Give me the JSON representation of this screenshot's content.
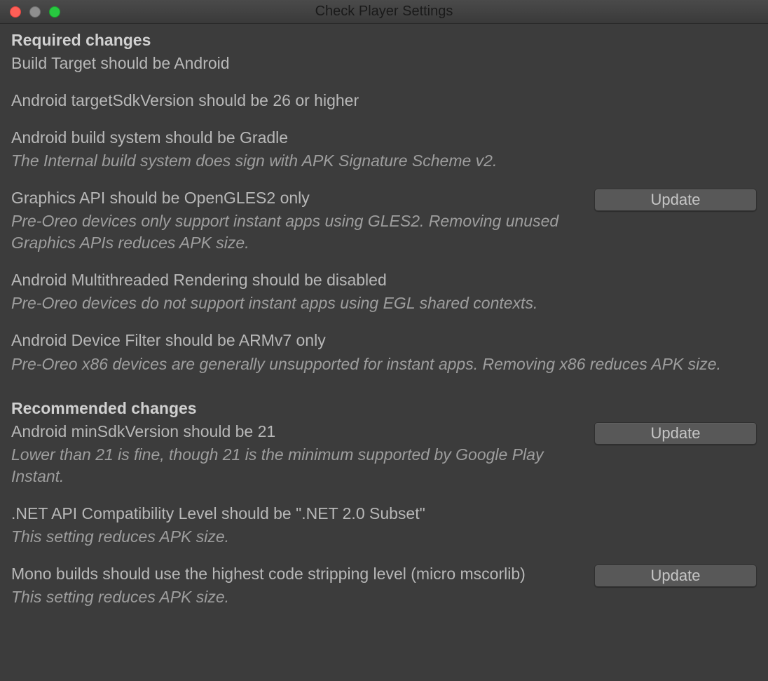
{
  "window": {
    "title": "Check Player Settings"
  },
  "buttons": {
    "update": "Update"
  },
  "sections": {
    "required": {
      "header": "Required changes",
      "items": [
        {
          "title": "Build Target should be Android",
          "desc": "",
          "hasButton": false
        },
        {
          "title": "Android targetSdkVersion should be 26 or higher",
          "desc": "",
          "hasButton": false
        },
        {
          "title": "Android build system should be Gradle",
          "desc": "The Internal build system does sign with APK Signature Scheme v2.",
          "hasButton": false
        },
        {
          "title": "Graphics API should be OpenGLES2 only",
          "desc": "Pre-Oreo devices only support instant apps using GLES2. Removing unused Graphics APIs reduces APK size.",
          "hasButton": true
        },
        {
          "title": "Android Multithreaded Rendering should be disabled",
          "desc": "Pre-Oreo devices do not support instant apps using EGL shared contexts.",
          "hasButton": false
        },
        {
          "title": "Android Device Filter should be ARMv7 only",
          "desc": "Pre-Oreo x86 devices are generally unsupported for instant apps. Removing x86 reduces APK size.",
          "hasButton": false
        }
      ]
    },
    "recommended": {
      "header": "Recommended changes",
      "items": [
        {
          "title": "Android minSdkVersion should be 21",
          "desc": "Lower than 21 is fine, though 21 is the minimum supported by Google Play Instant.",
          "hasButton": true
        },
        {
          "title": ".NET API Compatibility Level should be \".NET 2.0 Subset\"",
          "desc": "This setting reduces APK size.",
          "hasButton": false
        },
        {
          "title": "Mono builds should use the highest code stripping level (micro mscorlib)",
          "desc": "This setting reduces APK size.",
          "hasButton": true
        }
      ]
    }
  }
}
